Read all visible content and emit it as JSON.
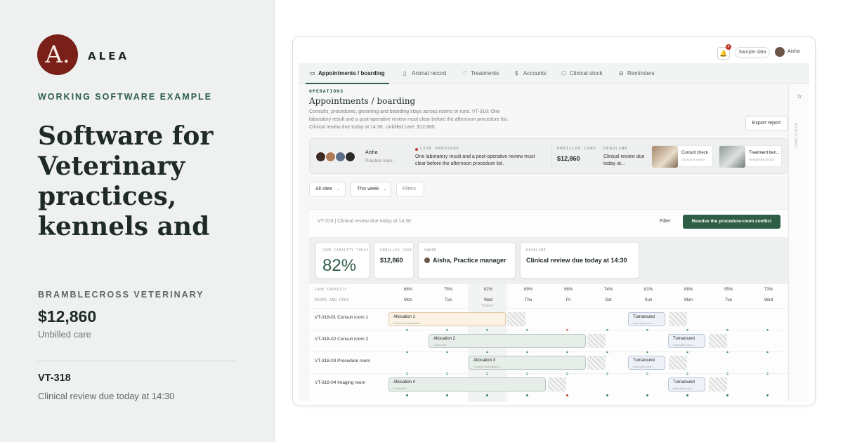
{
  "left": {
    "logo_letter": "A.",
    "brand": "ALEA",
    "kicker": "WORKING SOFTWARE EXAMPLE",
    "headline": "Software for Veterinary practices, kennels and",
    "practice": "BRAMBLECROSS VETERINARY",
    "amount": "$12,860",
    "amount_label": "Unbilled care",
    "ticket": "VT-318",
    "ticket_desc": "Clinical review due today at 14:30"
  },
  "topbar": {
    "notification_count": "4",
    "sample_label": "Sample data",
    "user_name": "Aisha"
  },
  "tabs": [
    {
      "label": "Appointments / boarding",
      "icon": "calendar-icon",
      "glyph": "▭",
      "active": true
    },
    {
      "label": "Animal record",
      "icon": "document-icon",
      "glyph": "▯",
      "active": false
    },
    {
      "label": "Treatments",
      "icon": "heart-icon",
      "glyph": "♡",
      "active": false
    },
    {
      "label": "Accounts",
      "icon": "dollar-icon",
      "glyph": "$",
      "active": false
    },
    {
      "label": "Clinical stock",
      "icon": "box-icon",
      "glyph": "⬡",
      "active": false
    },
    {
      "label": "Reminders",
      "icon": "inbox-icon",
      "glyph": "⊟",
      "active": false
    }
  ],
  "rail": {
    "label": "ASSISTANT",
    "icon": "star-icon"
  },
  "header": {
    "kicker": "OPERATIONS",
    "title": "Appointments / boarding",
    "description": "Consults, procedures, grooming and boarding stays across rooms or runs. VT-318: One laboratory result and a post-operative review must clear before the afternoon procedure list. Clinical review due today at 14:30. Unbilled care: $12,860.",
    "export_label": "Export report"
  },
  "summary": {
    "owner_name": "Aisha",
    "owner_role": "Practice man...",
    "live_kicker": "LIVE PRESSURE",
    "live_text": "One laboratory result and a post-operative review must clear before the afternoon procedure list.",
    "unbilled_kicker": "UNBILLED CARE",
    "unbilled_value": "$12,860",
    "deadline_kicker": "DEADLINE",
    "deadline_text": "Clinical review due today at...",
    "cards": [
      {
        "title": "Consult check",
        "sub": "Clinical evidence"
      },
      {
        "title": "Treatment ben...",
        "sub": "Residential record"
      }
    ]
  },
  "filters": {
    "sites": "All sites",
    "period": "This week",
    "filters": "Filters"
  },
  "panel": {
    "heading": "VT-318 | Clinical review due today at 14:30",
    "filter_label": "Filter",
    "resolve_label": "Resolve the procedure-room conflict",
    "metrics": {
      "capacity_kicker": "CARE CAPACITY TODAY",
      "capacity_value": "82%",
      "unbilled_kicker": "UNBILLED CARE",
      "unbilled_value": "$12,860",
      "owner_kicker": "OWNER",
      "owner_value": "Aisha, Practice manager",
      "deadline_kicker": "DEADLINE",
      "deadline_value": "Clinical review due today at 14:30"
    },
    "grid": {
      "capacity_label": "CARE CAPACITY",
      "rooms_label": "ROOMS AND RUNS",
      "today_label": "TODAY",
      "days": [
        {
          "day": "Mon",
          "capacity": "68%"
        },
        {
          "day": "Tue",
          "capacity": "75%"
        },
        {
          "day": "Wed",
          "capacity": "82%"
        },
        {
          "day": "Thu",
          "capacity": "89%"
        },
        {
          "day": "Fri",
          "capacity": "96%"
        },
        {
          "day": "Sat",
          "capacity": "74%"
        },
        {
          "day": "Sun",
          "capacity": "81%"
        },
        {
          "day": "Mon",
          "capacity": "88%"
        },
        {
          "day": "Tue",
          "capacity": "95%"
        },
        {
          "day": "Wed",
          "capacity": "73%"
        }
      ],
      "rows": [
        {
          "label": "VT-318-01 Consult room 1",
          "alloc_title": "Allocation 1",
          "alloc_sub": "Current reconciliation",
          "turn_title": "Turnaround",
          "turn_sub": "Inspection and r..."
        },
        {
          "label": "VT-318-02 Consult room 2",
          "alloc_title": "Allocation 2",
          "alloc_sub": "Confirmed",
          "turn_title": "Turnaround",
          "turn_sub": "Inspection and r..."
        },
        {
          "label": "VT-318-03 Procedure room",
          "alloc_title": "Allocation 3",
          "alloc_sub": "Current reconciliation",
          "turn_title": "Turnaround",
          "turn_sub": "Inspection and r..."
        },
        {
          "label": "VT-318-04 Imaging room",
          "alloc_title": "Allocation 4",
          "alloc_sub": "Confirmed",
          "turn_title": "Turnaround",
          "turn_sub": "Inspection and r..."
        }
      ]
    }
  },
  "colors": {
    "brand": "#7a2019",
    "accent": "#2f5e47",
    "alert": "#c0392b"
  }
}
